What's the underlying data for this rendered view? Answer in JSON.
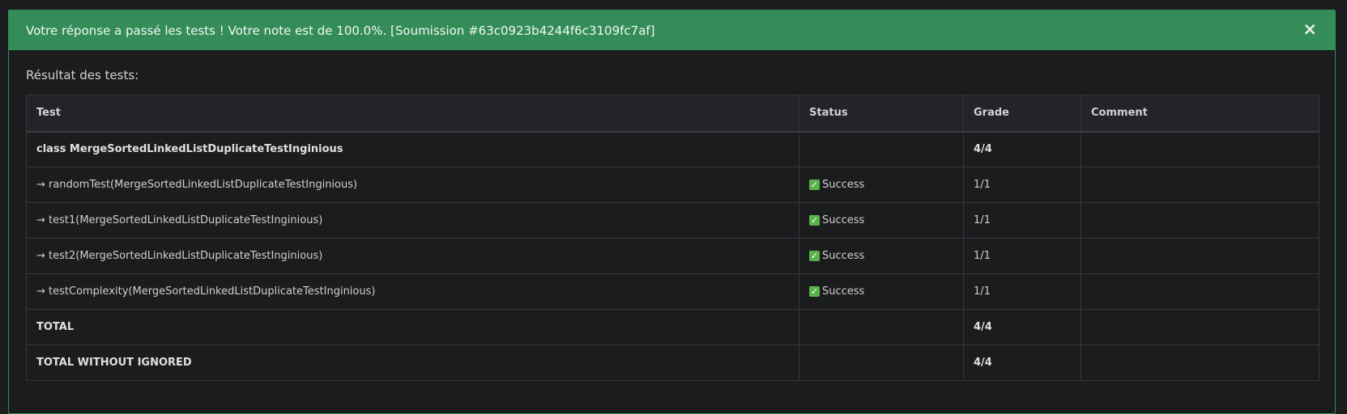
{
  "alert": {
    "message": "Votre réponse a passé les tests ! Votre note est de 100.0%. [Soumission #63c0923b4244f6c3109fc7af]",
    "close_symbol": "×",
    "accent_color": "#348d58"
  },
  "results": {
    "title": "Résultat des tests:",
    "columns": [
      "Test",
      "Status",
      "Grade",
      "Comment"
    ],
    "rows": [
      {
        "test": "class MergeSortedLinkedListDuplicateTestInginious",
        "status": "",
        "grade": "4/4",
        "comment": "",
        "bold": true
      },
      {
        "test": "→ randomTest(MergeSortedLinkedListDuplicateTestInginious)",
        "status": "Success",
        "grade": "1/1",
        "comment": "",
        "bold": false
      },
      {
        "test": "→ test1(MergeSortedLinkedListDuplicateTestInginious)",
        "status": "Success",
        "grade": "1/1",
        "comment": "",
        "bold": false
      },
      {
        "test": "→ test2(MergeSortedLinkedListDuplicateTestInginious)",
        "status": "Success",
        "grade": "1/1",
        "comment": "",
        "bold": false
      },
      {
        "test": "→ testComplexity(MergeSortedLinkedListDuplicateTestInginious)",
        "status": "Success",
        "grade": "1/1",
        "comment": "",
        "bold": false
      },
      {
        "test": "TOTAL",
        "status": "",
        "grade": "4/4",
        "comment": "",
        "bold": true
      },
      {
        "test": "TOTAL WITHOUT IGNORED",
        "status": "",
        "grade": "4/4",
        "comment": "",
        "bold": true
      }
    ],
    "success_icon": "check-mark-icon"
  }
}
